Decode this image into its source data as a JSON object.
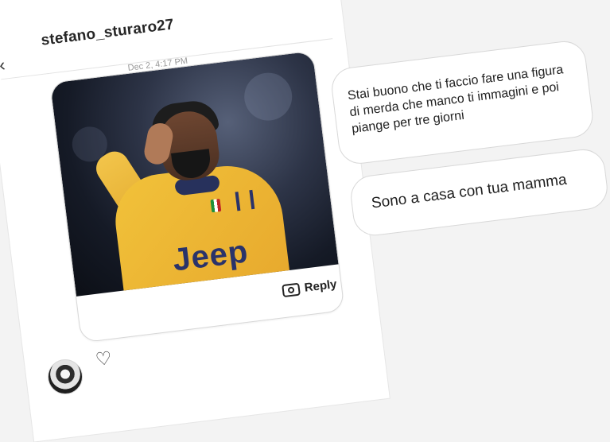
{
  "header": {
    "username": "stefano_sturaro27"
  },
  "conversation": {
    "timestamp": "Dec 2, 4:17 PM",
    "shared_post": {
      "reply_label": "Reply",
      "image_text": "Jeep"
    },
    "messages": [
      {
        "text": "Stai buono che ti faccio fare una figura di merda che manco ti immagini e poi piange per tre giorni"
      },
      {
        "text": "Sono a casa con tua mamma"
      }
    ]
  },
  "icons": {
    "back": "chevron-left-icon",
    "info": "info-icon",
    "camera": "camera-icon",
    "heart": "heart-icon"
  }
}
